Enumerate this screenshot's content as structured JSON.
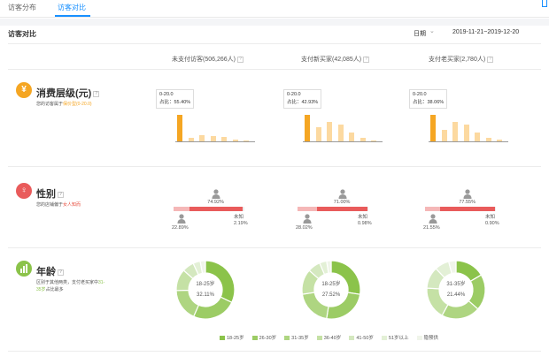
{
  "tabs": [
    {
      "label": "访客分布",
      "active": false
    },
    {
      "label": "访客对比",
      "active": true
    }
  ],
  "header": {
    "title": "访客对比",
    "period_select": "日期",
    "date_range": "2019-11-21~2019-12-20"
  },
  "columns": [
    {
      "label": "未支付访客(506,266人)"
    },
    {
      "label": "支付新买家(42,085人)"
    },
    {
      "label": "支付老买家(2,780人)"
    }
  ],
  "sections": {
    "consumption": {
      "icon": "yen-icon",
      "color": "#f5a623",
      "label": "消费层级(元)",
      "desc_prefix": "您的访客属于",
      "desc_highlight": "保价型(0-20.0)",
      "tooltips": [
        {
          "range": "0-20.0",
          "share": "占比：55.40%"
        },
        {
          "range": "0-20.0",
          "share": "占比：42.93%"
        },
        {
          "range": "0-20.0",
          "share": "占比：38.06%"
        }
      ],
      "bars": [
        [
          1.0,
          0.12,
          0.22,
          0.2,
          0.16,
          0.06,
          0.03
        ],
        [
          1.0,
          0.52,
          0.72,
          0.62,
          0.32,
          0.12,
          0.05
        ],
        [
          1.0,
          0.45,
          0.72,
          0.62,
          0.34,
          0.12,
          0.06
        ]
      ]
    },
    "gender": {
      "icon": "gender-icon",
      "color": "#e74c3c",
      "label": "性别",
      "desc_prefix": "您的店铺偏于",
      "desc_highlight": "女人知而",
      "groups": [
        {
          "female_pct": "74.92%",
          "male_pct": "22.89%",
          "unknown_label": "未知",
          "unknown_pct": "2.19%",
          "female": 0.749,
          "male": 0.229
        },
        {
          "female_pct": "71.00%",
          "male_pct": "28.02%",
          "unknown_label": "未知",
          "unknown_pct": "0.98%",
          "female": 0.71,
          "male": 0.28
        },
        {
          "female_pct": "77.55%",
          "male_pct": "21.55%",
          "unknown_label": "未知",
          "unknown_pct": "0.90%",
          "female": 0.776,
          "male": 0.216
        }
      ]
    },
    "age": {
      "icon": "age-bars-icon",
      "color": "#8bc34a",
      "label": "年龄",
      "desc_line1": "区别于其他两类，支付老买家中",
      "desc_highlight": "31-",
      "desc_line2_highlight": "35岁",
      "desc_line2_suffix": "占比最多",
      "donuts": [
        {
          "center_label": "18-25岁",
          "center_value": "32.11%",
          "values": [
            32.11,
            24.5,
            18.0,
            12.0,
            6.5,
            4.0,
            2.89
          ]
        },
        {
          "center_label": "18-25岁",
          "center_value": "27.52%",
          "values": [
            27.52,
            25.0,
            20.0,
            14.0,
            7.0,
            4.0,
            2.48
          ]
        },
        {
          "center_label": "31-35岁",
          "center_value": "21.44%",
          "values": [
            16.5,
            20.0,
            21.44,
            18.0,
            12.0,
            8.0,
            4.06
          ]
        }
      ],
      "legend": [
        "18-25岁",
        "26-30岁",
        "31-35岁",
        "36-40岁",
        "41-50岁",
        "51岁以上",
        "隐预供"
      ],
      "legend_colors": [
        "#8bc34a",
        "#9ccc65",
        "#aed581",
        "#c5e1a5",
        "#d4e8bf",
        "#e3f0d6",
        "#f0f5ea"
      ]
    }
  }
}
